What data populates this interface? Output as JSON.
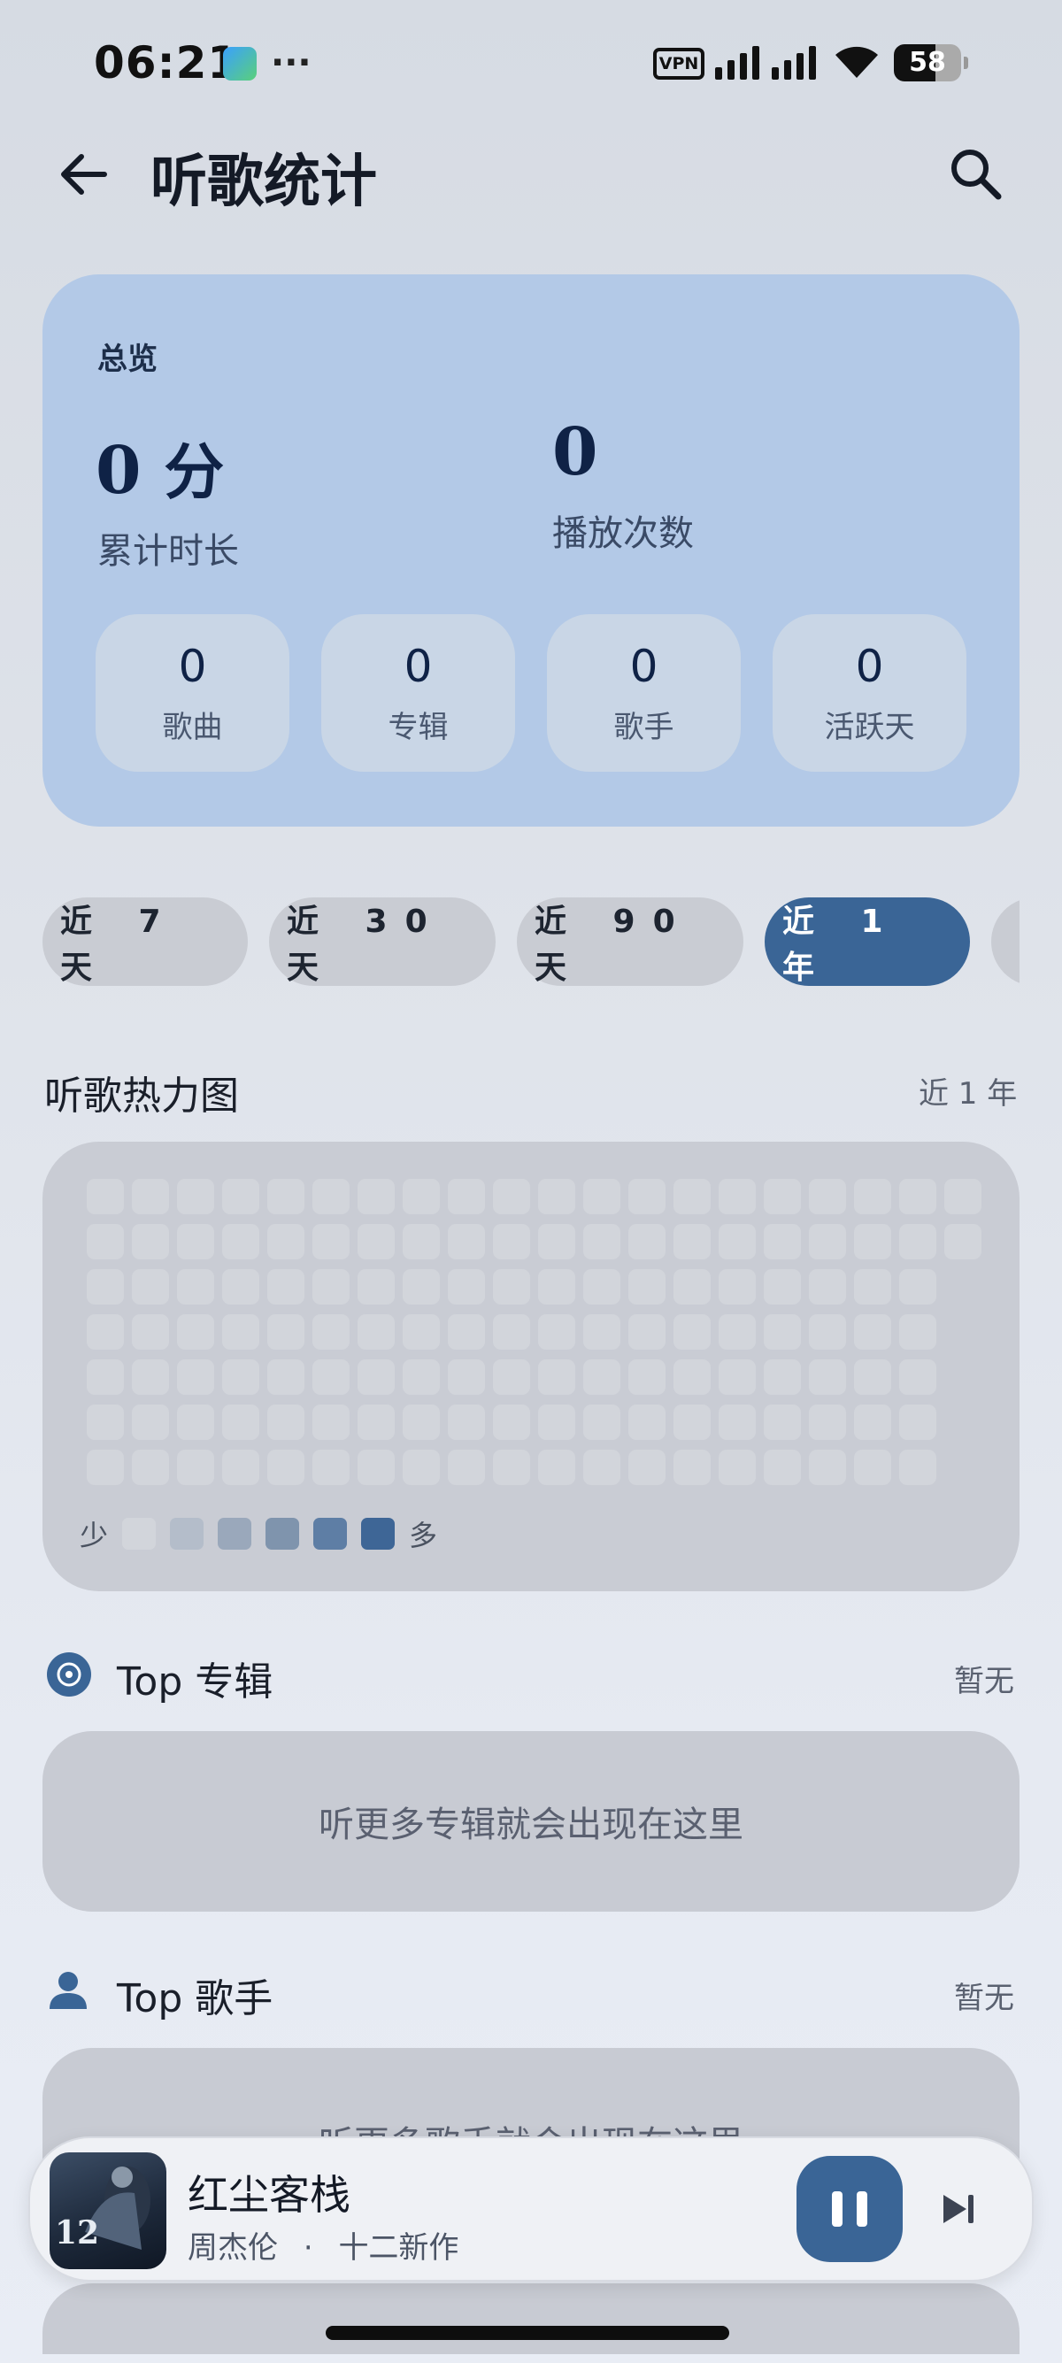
{
  "status_bar": {
    "time": "06:21",
    "more": "···",
    "vpn": "VPN",
    "battery": "58"
  },
  "header": {
    "title": "听歌统计",
    "back_icon": "arrow-left-icon",
    "search_icon": "search-icon"
  },
  "overview": {
    "label": "总览",
    "duration_value": "0",
    "duration_unit": "分",
    "duration_label": "累计时长",
    "plays_value": "0",
    "plays_label": "播放次数",
    "stats": [
      {
        "value": "0",
        "label": "歌曲"
      },
      {
        "value": "0",
        "label": "专辑"
      },
      {
        "value": "0",
        "label": "歌手"
      },
      {
        "value": "0",
        "label": "活跃天"
      }
    ]
  },
  "ranges": [
    {
      "label": "近 7 天",
      "active": false
    },
    {
      "label": "近 30 天",
      "active": false
    },
    {
      "label": "近 90 天",
      "active": false
    },
    {
      "label": "近 1 年",
      "active": true
    }
  ],
  "heatmap": {
    "title": "听歌热力图",
    "range": "近 1 年",
    "legend_low": "少",
    "legend_high": "多",
    "legend_colors": [
      "#d2d5db",
      "#b4bdca",
      "#9aa8bb",
      "#7f94ad",
      "#5e7ea5",
      "#3e6696"
    ]
  },
  "top_albums": {
    "title": "Top 专辑",
    "status": "暂无",
    "empty_text": "听更多专辑就会出现在这里"
  },
  "top_artists": {
    "title": "Top 歌手",
    "status": "暂无",
    "empty_text": "听更多歌手就会出现在这里"
  },
  "player": {
    "title": "红尘客栈",
    "artist": "周杰伦",
    "separator": "·",
    "album": "十二新作",
    "cover_text": "12",
    "accent": "#3a6596"
  }
}
